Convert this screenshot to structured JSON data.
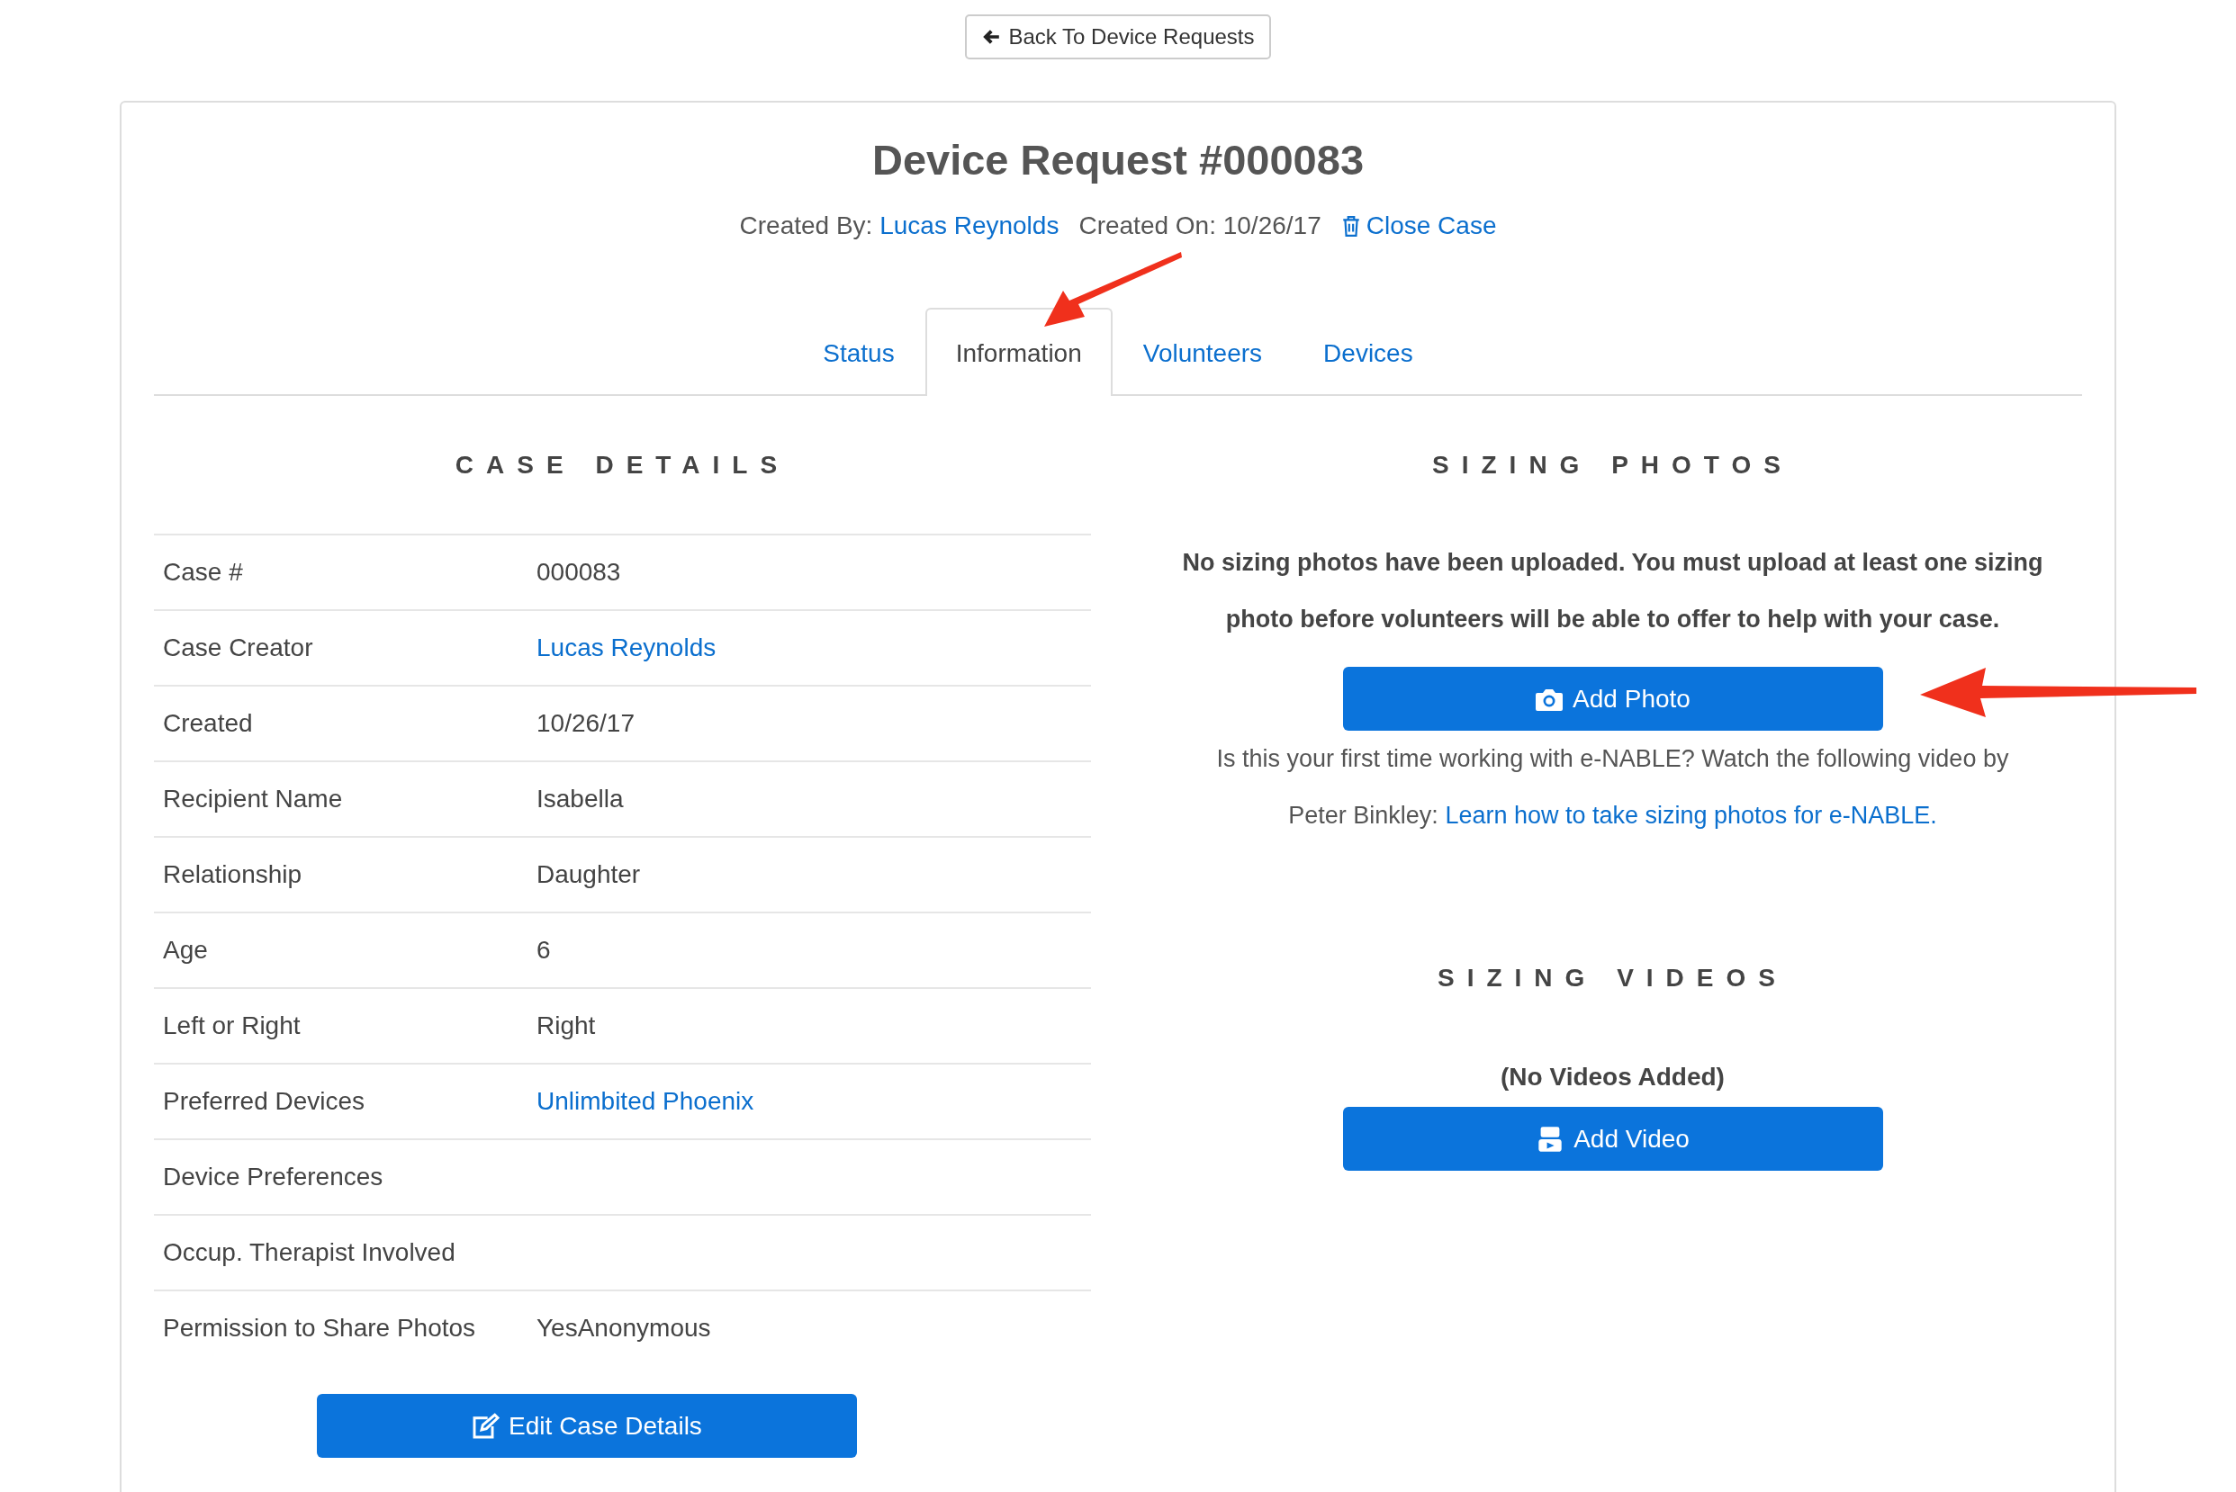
{
  "back_button": {
    "label": "Back To Device Requests"
  },
  "title": "Device Request #000083",
  "meta": {
    "created_by_label": "Created By:",
    "created_by": "Lucas Reynolds",
    "created_on": "Created On: 10/26/17",
    "close_case": "Close Case"
  },
  "tabs": [
    {
      "label": "Status",
      "selected": false
    },
    {
      "label": "Information",
      "selected": true
    },
    {
      "label": "Volunteers",
      "selected": false
    },
    {
      "label": "Devices",
      "selected": false
    }
  ],
  "case_details": {
    "heading": "CASE DETAILS",
    "rows": [
      {
        "label": "Case #",
        "value": "000083",
        "kind": "text"
      },
      {
        "label": "Case Creator",
        "value": "Lucas Reynolds",
        "kind": "link"
      },
      {
        "label": "Created",
        "value": "10/26/17",
        "kind": "text"
      },
      {
        "label": "Recipient Name",
        "value": "Isabella",
        "kind": "text"
      },
      {
        "label": "Relationship",
        "value": "Daughter",
        "kind": "text"
      },
      {
        "label": "Age",
        "value": "6",
        "kind": "text"
      },
      {
        "label": "Left or Right",
        "value": "Right",
        "kind": "text"
      },
      {
        "label": "Preferred Devices",
        "value": "Unlimbited Phoenix",
        "kind": "link"
      },
      {
        "label": "Device Preferences"
      },
      {
        "label": "Occup. Therapist Involved"
      },
      {
        "label": "Permission to Share Photos",
        "value": "YesAnonymous",
        "kind": "text"
      }
    ],
    "edit_button": "Edit Case Details"
  },
  "sizing_photos": {
    "heading": "SIZING PHOTOS",
    "notice": "No sizing photos have been uploaded. You must upload at least one sizing photo before volunteers will be able to offer to help with your case.",
    "add_button": "Add Photo",
    "intro": "Is this your first time working with e-NABLE? Watch the following video by Peter Binkley:",
    "link": "Learn how to take sizing photos for e-NABLE."
  },
  "sizing_videos": {
    "heading": "SIZING VIDEOS",
    "empty": "(No Videos Added)",
    "add_button": "Add Video"
  }
}
